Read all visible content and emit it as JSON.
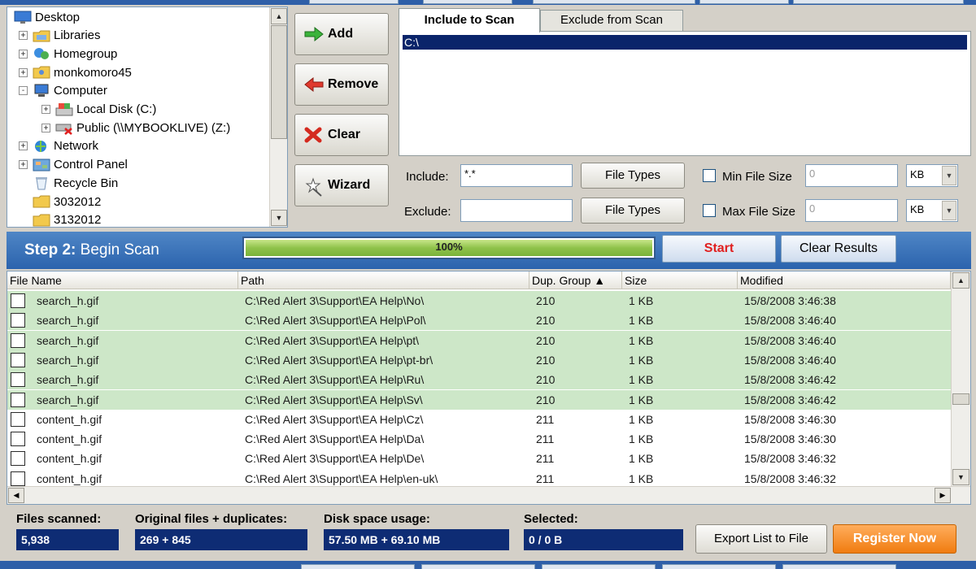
{
  "tree": {
    "items": [
      {
        "label": "Desktop",
        "icon": "desktop-icon",
        "level": 0,
        "expander": ""
      },
      {
        "label": "Libraries",
        "icon": "libraries-icon",
        "level": 1,
        "expander": "+"
      },
      {
        "label": "Homegroup",
        "icon": "homegroup-icon",
        "level": 1,
        "expander": "+"
      },
      {
        "label": "monkomoro45",
        "icon": "user-folder-icon",
        "level": 1,
        "expander": "+"
      },
      {
        "label": "Computer",
        "icon": "computer-icon",
        "level": 1,
        "expander": "-"
      },
      {
        "label": "Local Disk (C:)",
        "icon": "local-disk-icon",
        "level": 2,
        "expander": "+"
      },
      {
        "label": "Public (\\\\MYBOOKLIVE) (Z:)",
        "icon": "network-drive-disconnected-icon",
        "level": 2,
        "expander": "+"
      },
      {
        "label": "Network",
        "icon": "network-icon",
        "level": 1,
        "expander": "+"
      },
      {
        "label": "Control Panel",
        "icon": "control-panel-icon",
        "level": 1,
        "expander": "+"
      },
      {
        "label": "Recycle Bin",
        "icon": "recycle-bin-icon",
        "level": 1,
        "expander": ""
      },
      {
        "label": "3032012",
        "icon": "folder-icon",
        "level": 1,
        "expander": ""
      },
      {
        "label": "3132012",
        "icon": "folder-icon",
        "level": 1,
        "expander": ""
      }
    ]
  },
  "actions": {
    "add": "Add",
    "remove": "Remove",
    "clear": "Clear",
    "wizard": "Wizard"
  },
  "tabs": {
    "include": "Include to Scan",
    "exclude": "Exclude from Scan"
  },
  "scan_list": {
    "selected_path": "C:\\"
  },
  "filters": {
    "include_label": "Include:",
    "include_value": "*.*",
    "exclude_label": "Exclude:",
    "exclude_value": "",
    "file_types_1": "File Types",
    "file_types_2": "File Types",
    "min_size_label": "Min File Size",
    "min_size_value": "0",
    "min_size_unit": "KB",
    "max_size_label": "Max File Size",
    "max_size_value": "0",
    "max_size_unit": "KB"
  },
  "step2": {
    "step": "Step 2:",
    "title": "Begin Scan",
    "progress_label": "100%",
    "progress_value": 100,
    "start": "Start",
    "clear_results": "Clear Results"
  },
  "results": {
    "columns": [
      "File Name",
      "Path",
      "Dup. Group ▲",
      "Size",
      "Modified"
    ],
    "rows": [
      {
        "name": "search_h.gif",
        "path": "C:\\Red Alert 3\\Support\\EA Help\\No\\",
        "group": "210",
        "size": "1 KB",
        "modified": "15/8/2008 3:46:38",
        "highlight": true
      },
      {
        "name": "search_h.gif",
        "path": "C:\\Red Alert 3\\Support\\EA Help\\Pol\\",
        "group": "210",
        "size": "1 KB",
        "modified": "15/8/2008 3:46:40",
        "highlight": true
      },
      {
        "name": "search_h.gif",
        "path": "C:\\Red Alert 3\\Support\\EA Help\\pt\\",
        "group": "210",
        "size": "1 KB",
        "modified": "15/8/2008 3:46:40",
        "highlight": true
      },
      {
        "name": "search_h.gif",
        "path": "C:\\Red Alert 3\\Support\\EA Help\\pt-br\\",
        "group": "210",
        "size": "1 KB",
        "modified": "15/8/2008 3:46:40",
        "highlight": true
      },
      {
        "name": "search_h.gif",
        "path": "C:\\Red Alert 3\\Support\\EA Help\\Ru\\",
        "group": "210",
        "size": "1 KB",
        "modified": "15/8/2008 3:46:42",
        "highlight": true
      },
      {
        "name": "search_h.gif",
        "path": "C:\\Red Alert 3\\Support\\EA Help\\Sv\\",
        "group": "210",
        "size": "1 KB",
        "modified": "15/8/2008 3:46:42",
        "highlight": true
      },
      {
        "name": "content_h.gif",
        "path": "C:\\Red Alert 3\\Support\\EA Help\\Cz\\",
        "group": "211",
        "size": "1 KB",
        "modified": "15/8/2008 3:46:30",
        "highlight": false
      },
      {
        "name": "content_h.gif",
        "path": "C:\\Red Alert 3\\Support\\EA Help\\Da\\",
        "group": "211",
        "size": "1 KB",
        "modified": "15/8/2008 3:46:30",
        "highlight": false
      },
      {
        "name": "content_h.gif",
        "path": "C:\\Red Alert 3\\Support\\EA Help\\De\\",
        "group": "211",
        "size": "1 KB",
        "modified": "15/8/2008 3:46:32",
        "highlight": false
      },
      {
        "name": "content_h.gif",
        "path": "C:\\Red Alert 3\\Support\\EA Help\\en-uk\\",
        "group": "211",
        "size": "1 KB",
        "modified": "15/8/2008 3:46:32",
        "highlight": false
      }
    ]
  },
  "stats": {
    "files_scanned_label": "Files scanned:",
    "files_scanned": "5,938",
    "originals_label": "Original files + duplicates:",
    "originals": "269 + 845",
    "disk_label": "Disk space usage:",
    "disk": "57.50 MB + 69.10 MB",
    "selected_label": "Selected:",
    "selected": "0 / 0 B"
  },
  "footer": {
    "export": "Export List to File",
    "register": "Register Now"
  },
  "colors": {
    "highlight_row": "#cde7c8",
    "step_bar": "#2b63ad",
    "stat_box": "#0e2c74",
    "register": "#f07c10",
    "start_text": "#e02020"
  }
}
